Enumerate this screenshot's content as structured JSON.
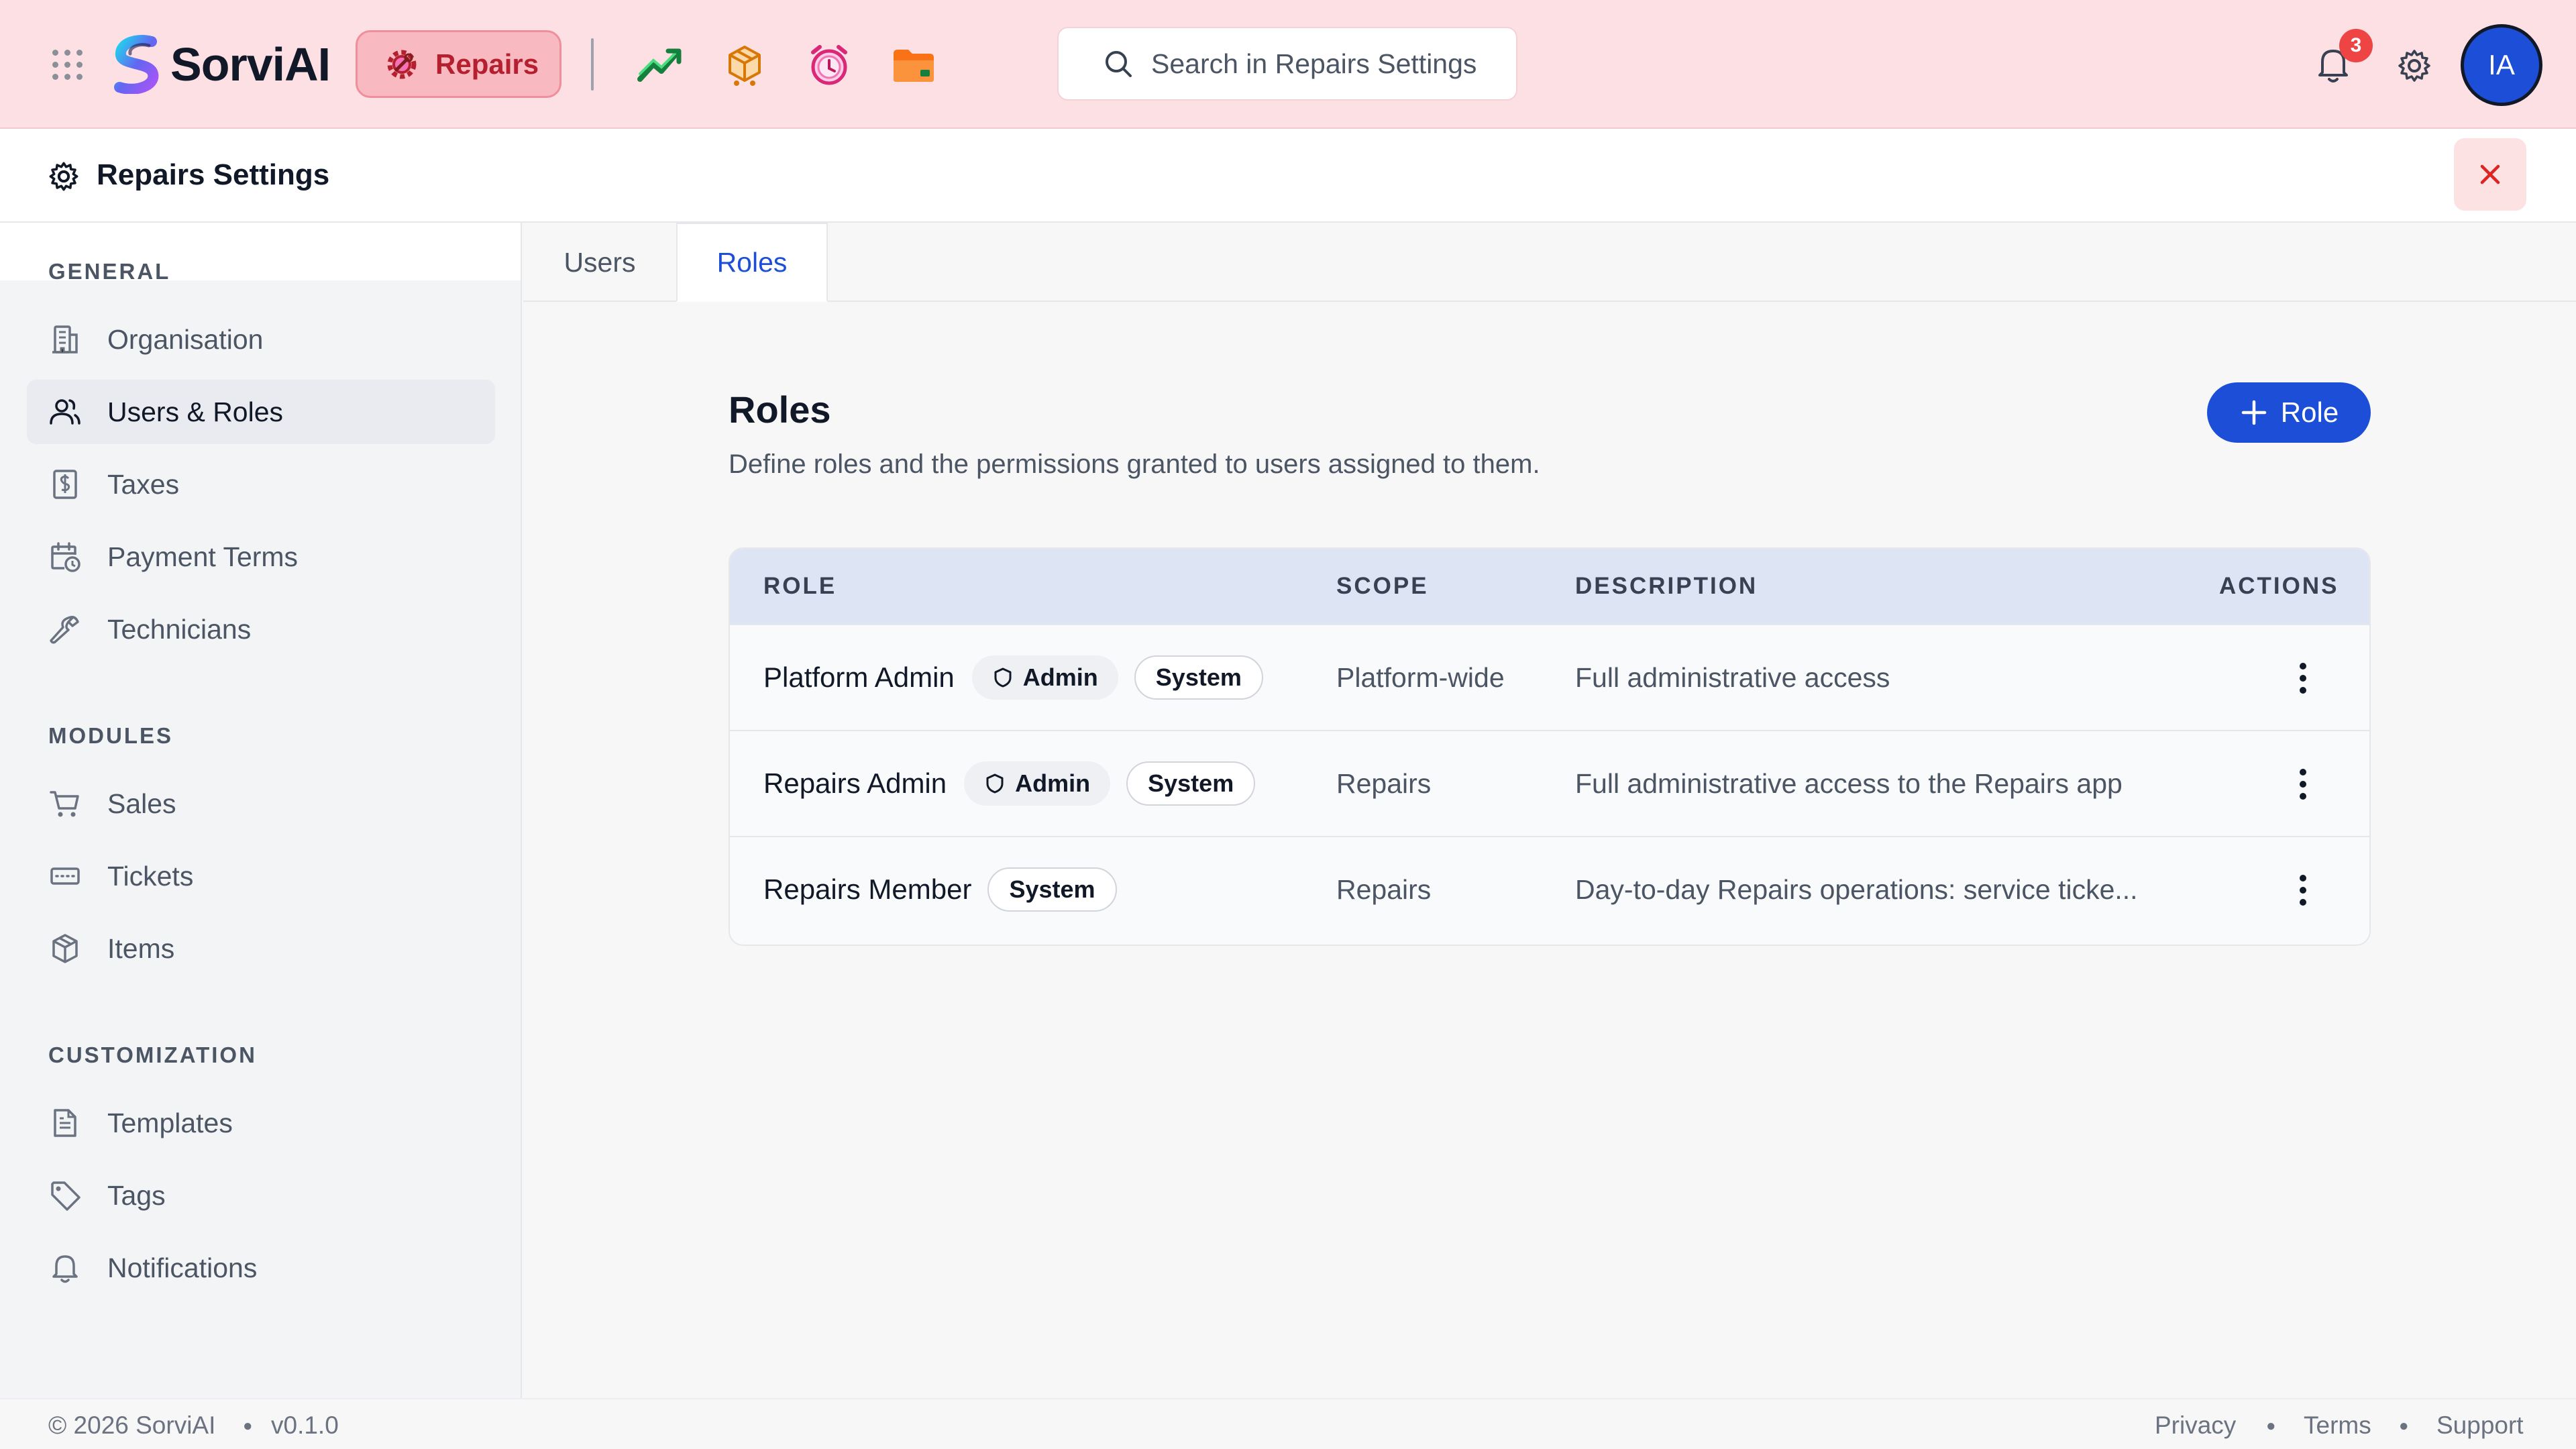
{
  "header": {
    "brand": "SorviAI",
    "active_app": "Repairs",
    "search_placeholder": "Search in Repairs Settings",
    "notification_count": "3",
    "avatar_initials": "IA",
    "apps": [
      "trend-up-icon",
      "box-cart-icon",
      "alarm-clock-icon",
      "folder-icon"
    ]
  },
  "settings": {
    "title": "Repairs Settings"
  },
  "sidebar": {
    "sections": [
      {
        "label": "GENERAL",
        "items": [
          "Organisation",
          "Users & Roles",
          "Taxes",
          "Payment Terms",
          "Technicians"
        ]
      },
      {
        "label": "MODULES",
        "items": [
          "Sales",
          "Tickets",
          "Items"
        ]
      },
      {
        "label": "CUSTOMIZATION",
        "items": [
          "Templates",
          "Tags",
          "Notifications"
        ]
      }
    ],
    "active_item": "Users & Roles"
  },
  "tabs": [
    "Users",
    "Roles"
  ],
  "active_tab": "Roles",
  "main": {
    "title": "Roles",
    "subtitle": "Define roles and the permissions granted to users assigned to them.",
    "add_button": "Role"
  },
  "table": {
    "columns": [
      "ROLE",
      "SCOPE",
      "DESCRIPTION",
      "ACTIONS"
    ],
    "rows": [
      {
        "role": "Platform Admin",
        "admin_badge": "Admin",
        "system_badge": "System",
        "scope": "Platform-wide",
        "description": "Full administrative access"
      },
      {
        "role": "Repairs Admin",
        "admin_badge": "Admin",
        "system_badge": "System",
        "scope": "Repairs",
        "description": "Full administrative access to the Repairs app"
      },
      {
        "role": "Repairs Member",
        "admin_badge": null,
        "system_badge": "System",
        "scope": "Repairs",
        "description": "Day-to-day Repairs operations: service ticke..."
      }
    ]
  },
  "footer": {
    "copyright": "© 2026 SorviAI",
    "version": "v0.1.0",
    "links": [
      "Privacy",
      "Terms",
      "Support"
    ]
  },
  "colors": {
    "topbar_bg": "#fde0e3",
    "accent": "#1d4ed8",
    "repairs_pill": "#f8b9c0",
    "badge": "#ef4444"
  }
}
